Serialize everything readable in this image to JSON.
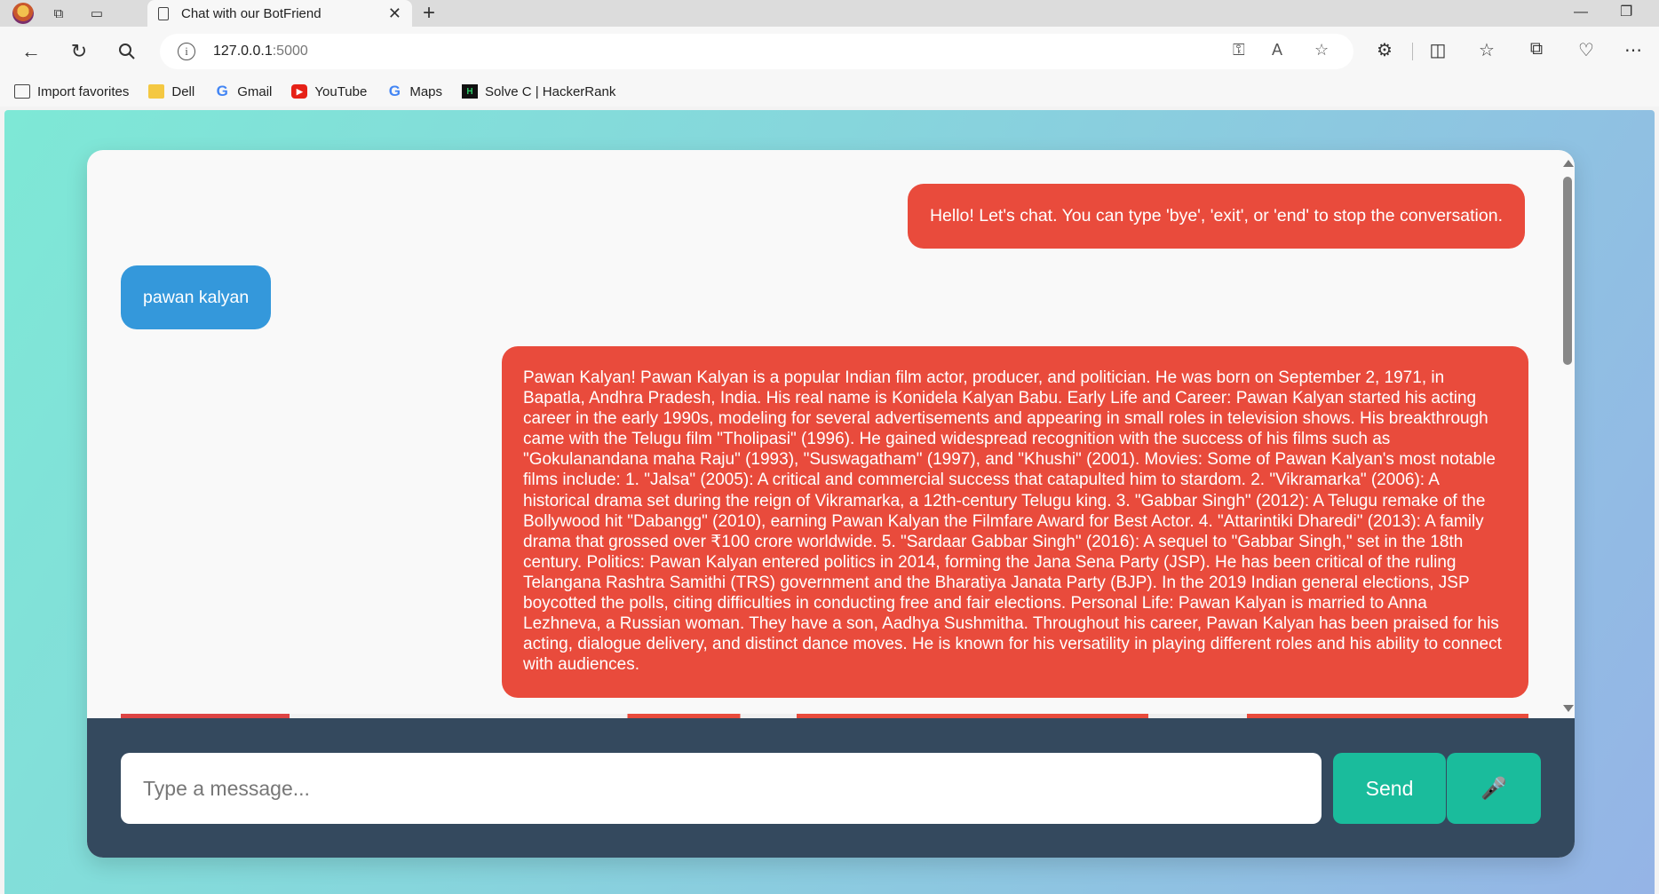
{
  "browser": {
    "tab_title": "Chat with our BotFriend",
    "tab_close": "✕",
    "new_tab": "+",
    "url_host": "127.0.0.1",
    "url_port": ":5000",
    "window_minimize": "—",
    "window_maximize": "❐"
  },
  "favorites": [
    {
      "label": "Import favorites",
      "icon": "import-icon"
    },
    {
      "label": "Dell",
      "icon": "folder-icon"
    },
    {
      "label": "Gmail",
      "icon": "google-icon"
    },
    {
      "label": "YouTube",
      "icon": "youtube-icon"
    },
    {
      "label": "Maps",
      "icon": "google-icon"
    },
    {
      "label": "Solve C | HackerRank",
      "icon": "hackerrank-icon"
    }
  ],
  "chat": {
    "messages": [
      {
        "sender": "bot",
        "text": "Hello! Let's chat. You can type 'bye', 'exit', or 'end' to stop the conversation."
      },
      {
        "sender": "user",
        "text": "pawan kalyan"
      },
      {
        "sender": "bot",
        "text": "Pawan Kalyan! Pawan Kalyan is a popular Indian film actor, producer, and politician. He was born on September 2, 1971, in Bapatla, Andhra Pradesh, India. His real name is Konidela Kalyan Babu. Early Life and Career: Pawan Kalyan started his acting career in the early 1990s, modeling for several advertisements and appearing in small roles in television shows. His breakthrough came with the Telugu film \"Tholipasi\" (1996). He gained widespread recognition with the success of his films such as \"Gokulanandana maha Raju\" (1993), \"Suswagatham\" (1997), and \"Khushi\" (2001). Movies: Some of Pawan Kalyan's most notable films include: 1. \"Jalsa\" (2005): A critical and commercial success that catapulted him to stardom. 2. \"Vikramarka\" (2006): A historical drama set during the reign of Vikramarka, a 12th-century Telugu king. 3. \"Gabbar Singh\" (2012): A Telugu remake of the Bollywood hit \"Dabangg\" (2010), earning Pawan Kalyan the Filmfare Award for Best Actor. 4. \"Attarintiki Dharedi\" (2013): A family drama that grossed over ₹100 crore worldwide. 5. \"Sardaar Gabbar Singh\" (2016): A sequel to \"Gabbar Singh,\" set in the 18th century. Politics: Pawan Kalyan entered politics in 2014, forming the Jana Sena Party (JSP). He has been critical of the ruling Telangana Rashtra Samithi (TRS) government and the Bharatiya Janata Party (BJP). In the 2019 Indian general elections, JSP boycotted the polls, citing difficulties in conducting free and fair elections. Personal Life: Pawan Kalyan is married to Anna Lezhneva, a Russian woman. They have a son, Aadhya Sushmitha. Throughout his career, Pawan Kalyan has been praised for his acting, dialogue delivery, and distinct dance moves. He is known for his versatility in playing different roles and his ability to connect with audiences."
      }
    ],
    "input_placeholder": "Type a message...",
    "input_value": "",
    "send_label": "Send",
    "mic_icon": "microphone-icon"
  },
  "colors": {
    "bot_bubble": "#e94b3c",
    "user_bubble": "#3498db",
    "input_bar": "#34495e",
    "button": "#1abc9c"
  }
}
